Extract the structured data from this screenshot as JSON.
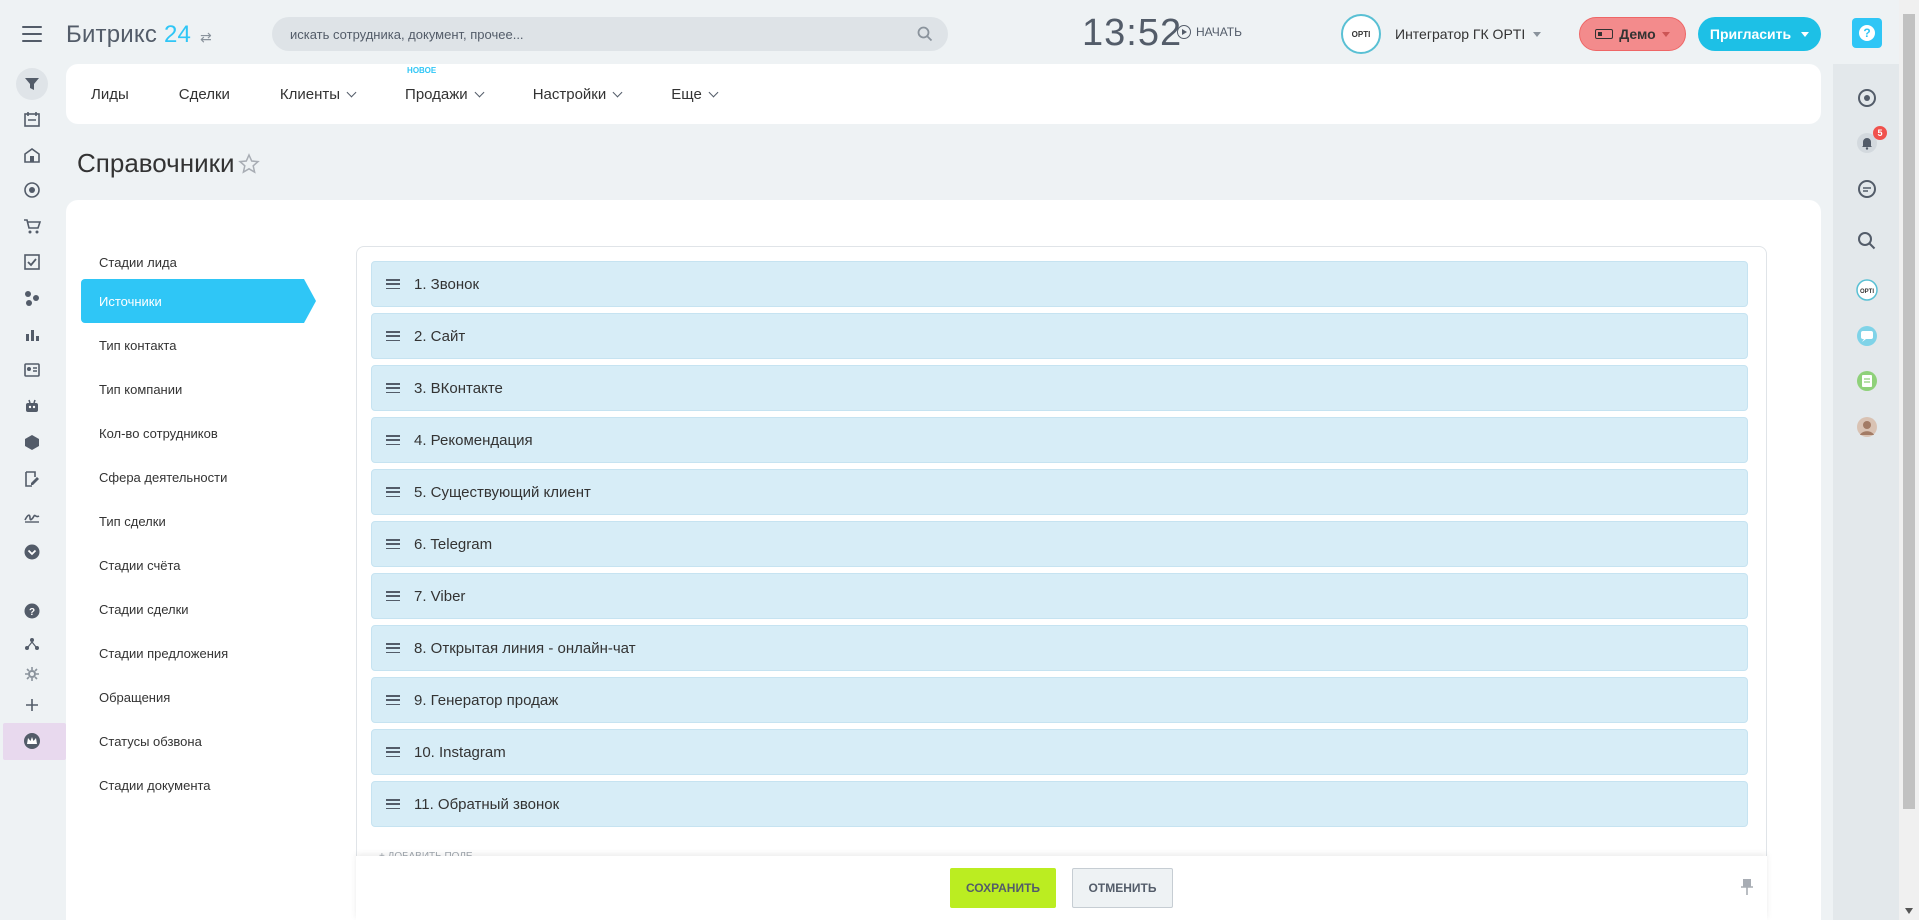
{
  "header": {
    "logo_text": "Битрикс",
    "logo_num": "24",
    "search_placeholder": "искать сотрудника, документ, прочее...",
    "clock": "13:52",
    "start_label": "НАЧАТЬ",
    "user_name": "Интегратор ГК OPTI",
    "avatar_text": "OPTI",
    "demo_label": "Демо",
    "invite_label": "Пригласить",
    "help_label": "?"
  },
  "top_nav": {
    "items": [
      {
        "label": "Лиды"
      },
      {
        "label": "Сделки"
      },
      {
        "label": "Клиенты"
      },
      {
        "label": "Продажи",
        "badge": "НОВОЕ"
      },
      {
        "label": "Настройки"
      },
      {
        "label": "Еще"
      }
    ]
  },
  "page": {
    "title": "Справочники"
  },
  "side_menu": {
    "items": [
      {
        "label": "Стадии лида"
      },
      {
        "label": "Источники"
      },
      {
        "label": "Тип контакта"
      },
      {
        "label": "Тип компании"
      },
      {
        "label": "Кол-во сотрудников"
      },
      {
        "label": "Сфера деятельности"
      },
      {
        "label": "Тип сделки"
      },
      {
        "label": "Стадии счёта"
      },
      {
        "label": "Стадии сделки"
      },
      {
        "label": "Стадии предложения"
      },
      {
        "label": "Обращения"
      },
      {
        "label": "Статусы обзвона"
      },
      {
        "label": "Стадии документа"
      }
    ]
  },
  "list": {
    "items": [
      {
        "label": "1. Звонок"
      },
      {
        "label": "2. Сайт"
      },
      {
        "label": "3. ВКонтакте"
      },
      {
        "label": "4. Рекомендация"
      },
      {
        "label": "5. Существующий клиент"
      },
      {
        "label": "6. Telegram"
      },
      {
        "label": "7. Viber"
      },
      {
        "label": "8. Открытая линия - онлайн-чат"
      },
      {
        "label": "9. Генератор продаж"
      },
      {
        "label": "10. Instagram"
      },
      {
        "label": "11. Обратный звонок"
      }
    ],
    "add_field_label": "+ ДОБАВИТЬ ПОЛЕ"
  },
  "footer": {
    "save_label": "СОХРАНИТЬ",
    "cancel_label": "ОТМЕНИТЬ"
  },
  "notifications": {
    "count": "5"
  },
  "colors": {
    "accent": "#2fc6f6",
    "row_bg": "#d7edf7",
    "save_green": "#bbed21",
    "demo_red": "#f38b8c"
  }
}
